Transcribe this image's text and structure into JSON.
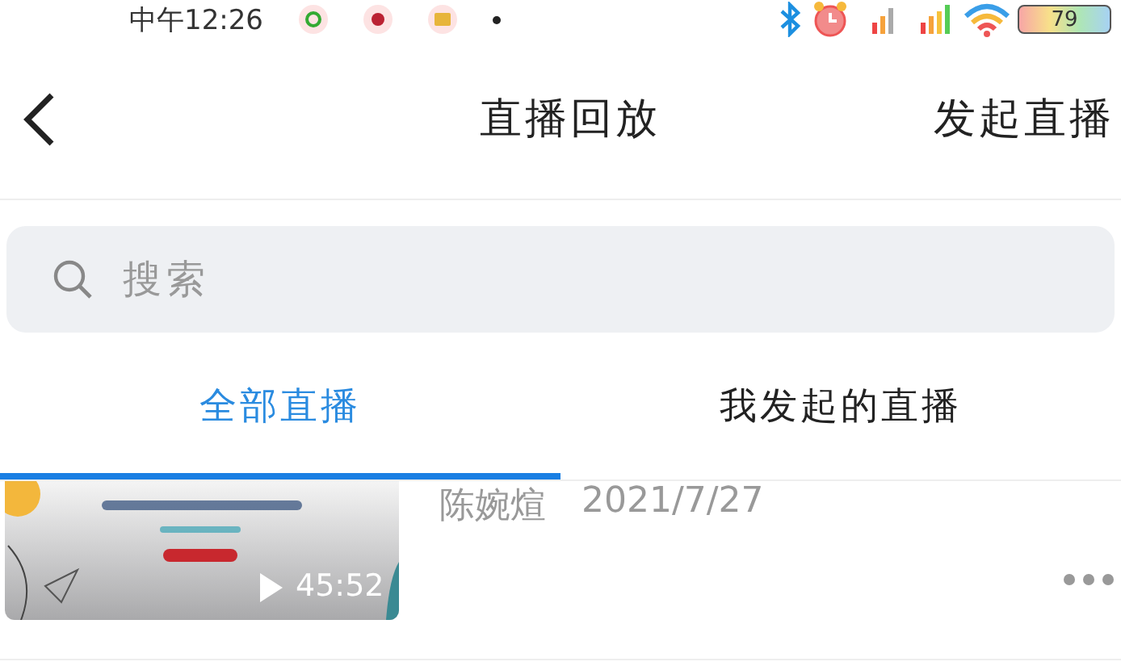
{
  "status_bar": {
    "time": "中午12:26",
    "battery": "79"
  },
  "header": {
    "title": "直播回放",
    "action": "发起直播"
  },
  "search": {
    "placeholder": "搜索"
  },
  "tabs": [
    {
      "label": "全部直播",
      "selected": true
    },
    {
      "label": "我发起的直播",
      "selected": false
    }
  ],
  "items": [
    {
      "thumbnail": {
        "kind": "picture",
        "duration": "45:52"
      },
      "author": "陈婉煊",
      "date": "2021/7/27"
    }
  ]
}
